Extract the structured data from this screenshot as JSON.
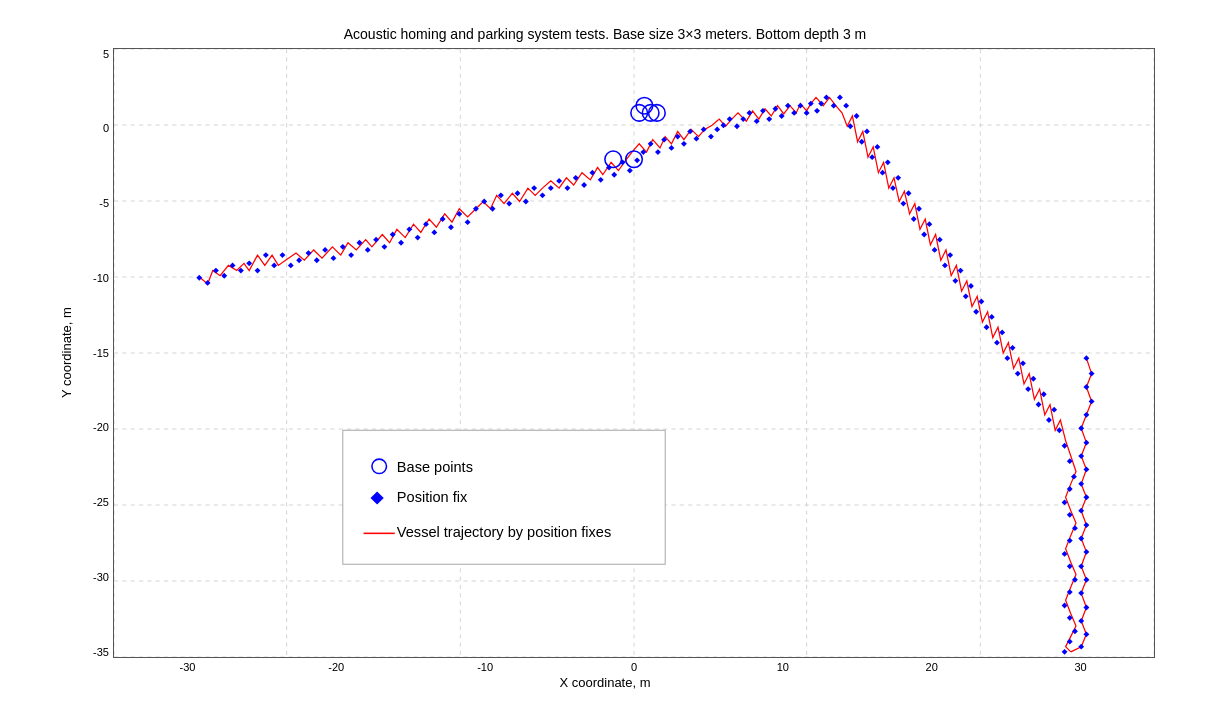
{
  "chart": {
    "title": "Acoustic homing and parking system tests. Base size 3×3 meters. Bottom depth 3 m",
    "x_label": "X coordinate, m",
    "y_label": "Y coordinate, m",
    "x_ticks": [
      "-30",
      "-20",
      "-10",
      "0",
      "10",
      "20",
      "30"
    ],
    "y_ticks": [
      "5",
      "0",
      "-5",
      "-10",
      "-15",
      "-20",
      "-25",
      "-30",
      "-35"
    ],
    "x_range": {
      "min": -30,
      "max": 30
    },
    "y_range": {
      "min": -35,
      "max": 5
    },
    "legend": {
      "items": [
        {
          "label": "Base points",
          "type": "circle"
        },
        {
          "label": "Position fix",
          "type": "diamond"
        },
        {
          "label": "Vessel trajectory by position fixes",
          "type": "line"
        }
      ]
    }
  }
}
